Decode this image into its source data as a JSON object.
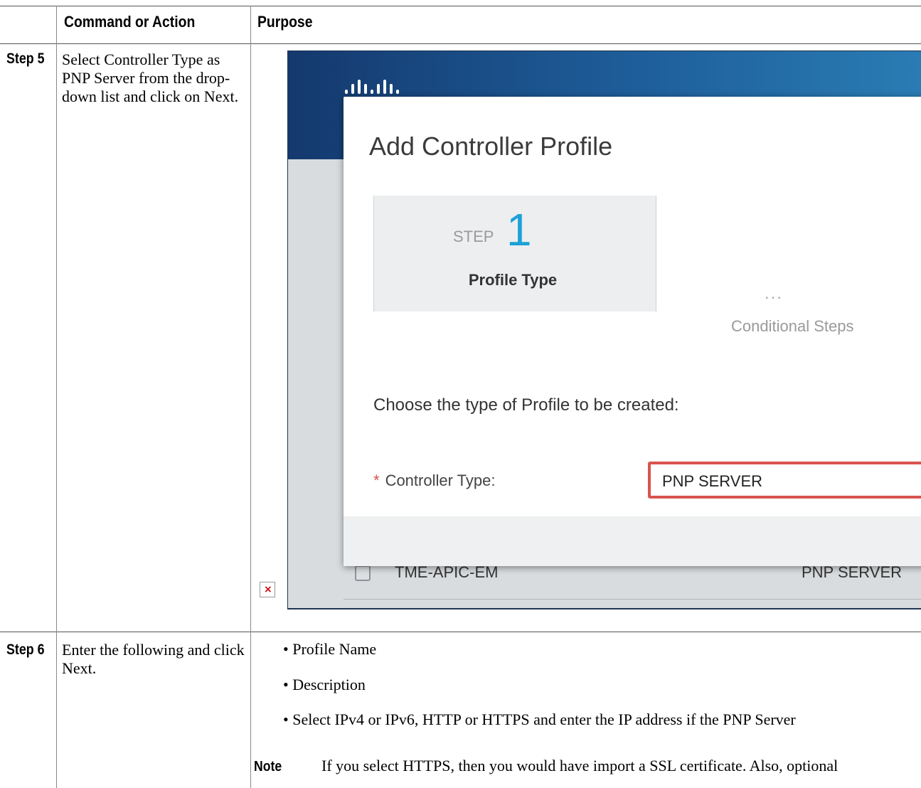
{
  "table": {
    "header": {
      "col1": "Command or Action",
      "col2": "Purpose"
    },
    "rows": [
      {
        "step": "Step 5",
        "action": "Select Controller Type as PNP Server from the drop-down list and click on Next."
      },
      {
        "step": "Step 6",
        "action": "Enter the following and click Next.",
        "bullets": [
          "Profile Name",
          "Description",
          "Select IPv4 or IPv6, HTTP or HTTPS and enter the IP address if the PNP Server"
        ],
        "note_label": "Note",
        "note_text": "If you select HTTPS, then you would have import a SSL certificate. Also, optional"
      }
    ]
  },
  "screenshot": {
    "modal_title": "Add Controller Profile",
    "step_word": "STEP",
    "step_number": "1",
    "step_name": "Profile Type",
    "next_step_dots": "...",
    "next_step_name": "Conditional Steps",
    "choose_text": "Choose the type of Profile to be created:",
    "controller_label": "Controller Type:",
    "required_mark": "*",
    "controller_value": "PNP SERVER",
    "background_row": {
      "name": "TME-APIC-EM",
      "type": "PNP SERVER"
    },
    "colors": {
      "header_blue": "#14396e",
      "step_accent": "#1da1d8",
      "highlight_red": "#d9534f"
    }
  },
  "broken_image_icon": "×"
}
